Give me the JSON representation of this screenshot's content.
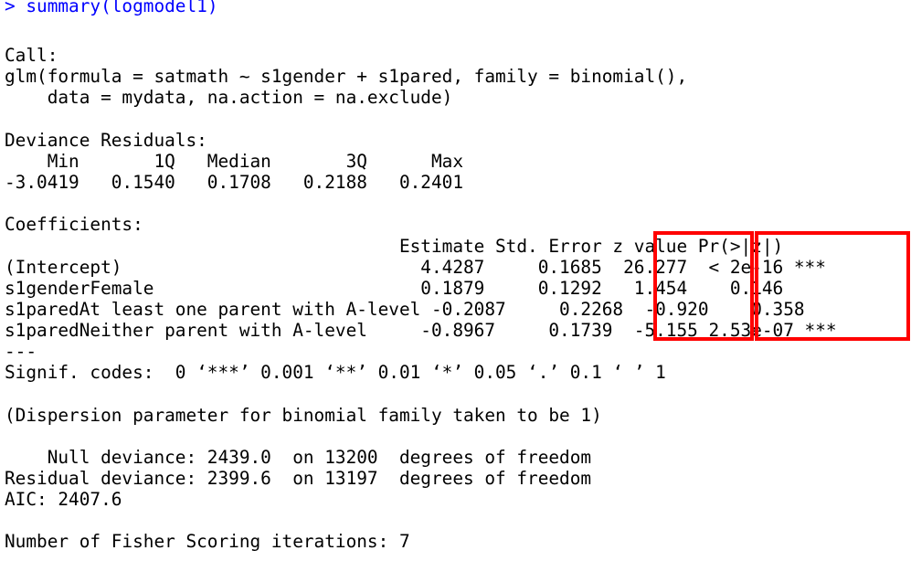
{
  "console": {
    "prompt": "> ",
    "command": "summary(logmodel1)",
    "lines": [
      "",
      "Call:",
      "glm(formula = satmath ~ s1gender + s1pared, family = binomial(),",
      "    data = mydata, na.action = na.exclude)",
      "",
      "Deviance Residuals:",
      "    Min       1Q   Median       3Q      Max  ",
      "-3.0419   0.1540   0.1708   0.2188   0.2401  ",
      "",
      "Coefficients:",
      "                                     Estimate Std. Error z value Pr(>|z|)    ",
      "(Intercept)                            4.4287     0.1685  26.277  < 2e-16 ***",
      "s1genderFemale                         0.1879     0.1292   1.454    0.146    ",
      "s1paredAt least one parent with A-level -0.2087     0.2268  -0.920    0.358    ",
      "s1paredNeither parent with A-level     -0.8967     0.1739  -5.155 2.53e-07 ***",
      "---",
      "Signif. codes:  0 ‘***’ 0.001 ‘**’ 0.01 ‘*’ 0.05 ‘.’ 0.1 ‘ ’ 1",
      "",
      "(Dispersion parameter for binomial family taken to be 1)",
      "",
      "    Null deviance: 2439.0  on 13200  degrees of freedom",
      "Residual deviance: 2399.6  on 13197  degrees of freedom",
      "AIC: 2407.6",
      "",
      "Number of Fisher Scoring iterations: 7"
    ]
  },
  "highlight_color": "#ff0000",
  "command_color": "#0000ff"
}
